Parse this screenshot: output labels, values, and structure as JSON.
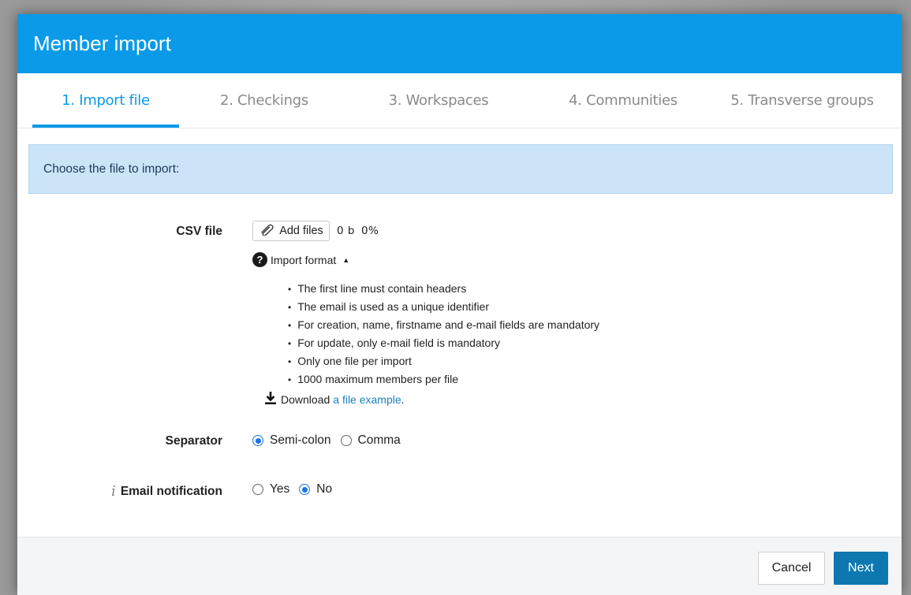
{
  "dialog": {
    "title": "Member import"
  },
  "tabs": [
    {
      "label": "1. Import file",
      "active": true
    },
    {
      "label": "2. Checkings",
      "active": false
    },
    {
      "label": "3. Workspaces",
      "active": false
    },
    {
      "label": "4. Communities",
      "active": false
    },
    {
      "label": "5. Transverse groups",
      "active": false
    }
  ],
  "banner": {
    "text": "Choose the file to import:"
  },
  "csv": {
    "label": "CSV file",
    "add_files_label": "Add files",
    "size": "0 b",
    "progress": "0%",
    "format_toggle_label": "Import format",
    "rules": [
      "The first line must contain headers",
      "The email is used as a unique identifier",
      "For creation, name, firstname and e-mail fields are mandatory",
      "For update, only e-mail field is mandatory",
      "Only one file per import",
      "1000 maximum members per file"
    ],
    "download_prefix": "Download",
    "download_link": "a file example",
    "download_suffix": "."
  },
  "separator": {
    "label": "Separator",
    "options": [
      "Semi-colon",
      "Comma"
    ],
    "selected": "Semi-colon"
  },
  "email_notification": {
    "label": "Email notification",
    "options": [
      "Yes",
      "No"
    ],
    "selected": "No"
  },
  "footer": {
    "cancel_label": "Cancel",
    "next_label": "Next"
  },
  "colors": {
    "accent": "#0a9ae8",
    "banner_bg": "#cce4f8",
    "primary_button": "#0d78b0",
    "link": "#1a7fc0"
  }
}
